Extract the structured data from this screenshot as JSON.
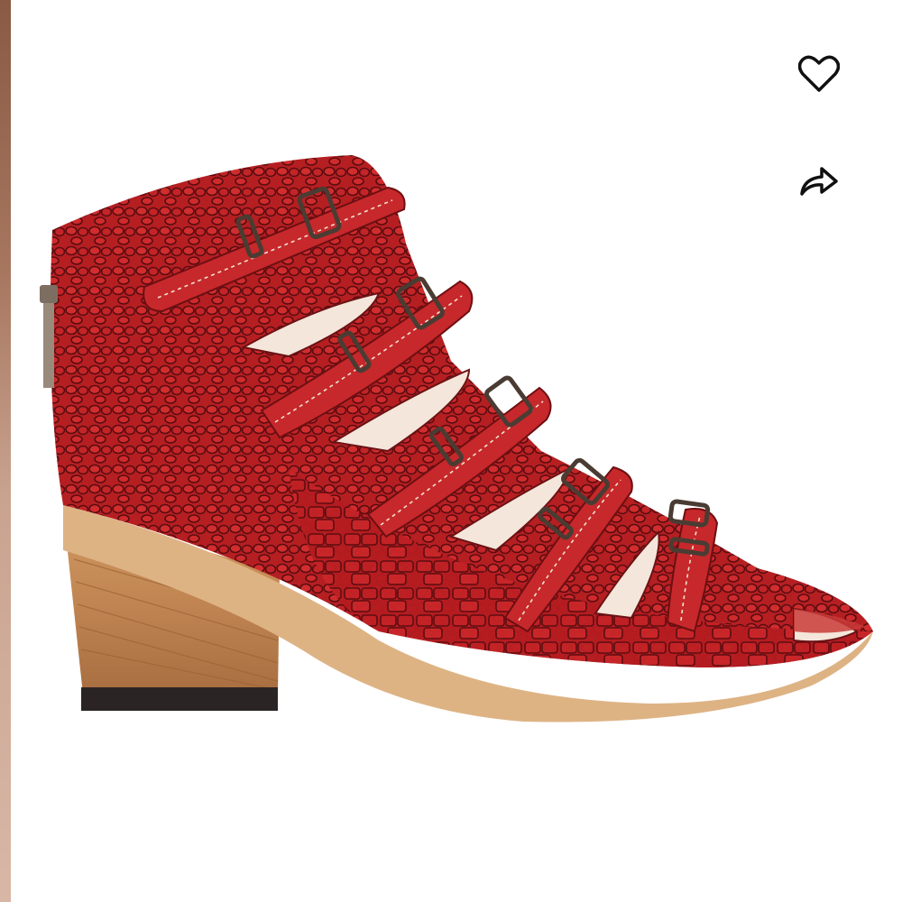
{
  "product": {
    "image": "red-croc-buckle-block-heel-sandal",
    "colors": {
      "leather": "#b51f22",
      "leather_dark": "#6d0f12",
      "heel_wood": "#c98d55",
      "buckle": "#5a4a3e",
      "sole_edge": "#deb384"
    }
  },
  "actions": {
    "favorite_icon": "heart-outline-icon",
    "share_icon": "share-arrow-icon"
  },
  "accent": "#111111"
}
